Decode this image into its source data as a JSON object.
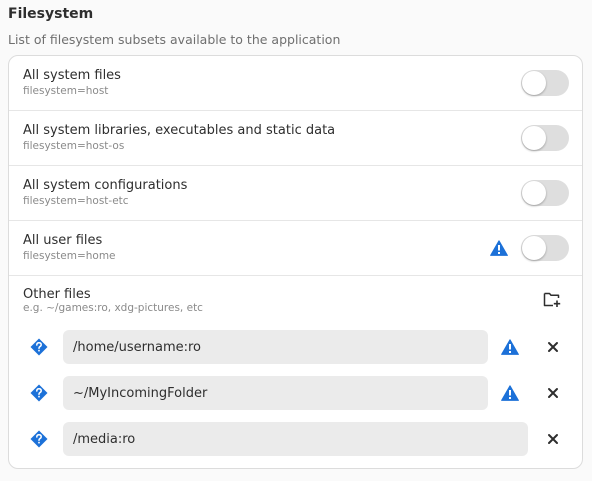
{
  "section": {
    "title": "Filesystem",
    "subtitle": "List of filesystem subsets available to the application"
  },
  "rows": [
    {
      "title": "All system files",
      "subtitle": "filesystem=host",
      "enabled": false,
      "warning": false
    },
    {
      "title": "All system libraries, executables and static data",
      "subtitle": "filesystem=host-os",
      "enabled": false,
      "warning": false
    },
    {
      "title": "All system configurations",
      "subtitle": "filesystem=host-etc",
      "enabled": false,
      "warning": false
    },
    {
      "title": "All user files",
      "subtitle": "filesystem=home",
      "enabled": false,
      "warning": true
    }
  ],
  "other_files": {
    "title": "Other files",
    "subtitle": "e.g. ~/games:ro, xdg-pictures, etc",
    "entries": [
      {
        "value": "/home/username:ro",
        "warning": true
      },
      {
        "value": "~/MyIncomingFolder",
        "warning": true
      },
      {
        "value": "/media:ro",
        "warning": false
      }
    ]
  },
  "icons": {
    "warning": "warning-icon",
    "help": "help-diamond-icon",
    "remove": "close-icon",
    "add_folder": "folder-add-icon"
  },
  "colors": {
    "accent": "#1c71d8",
    "toggle_off": "#dedede",
    "entry_bg": "#ebebeb"
  }
}
